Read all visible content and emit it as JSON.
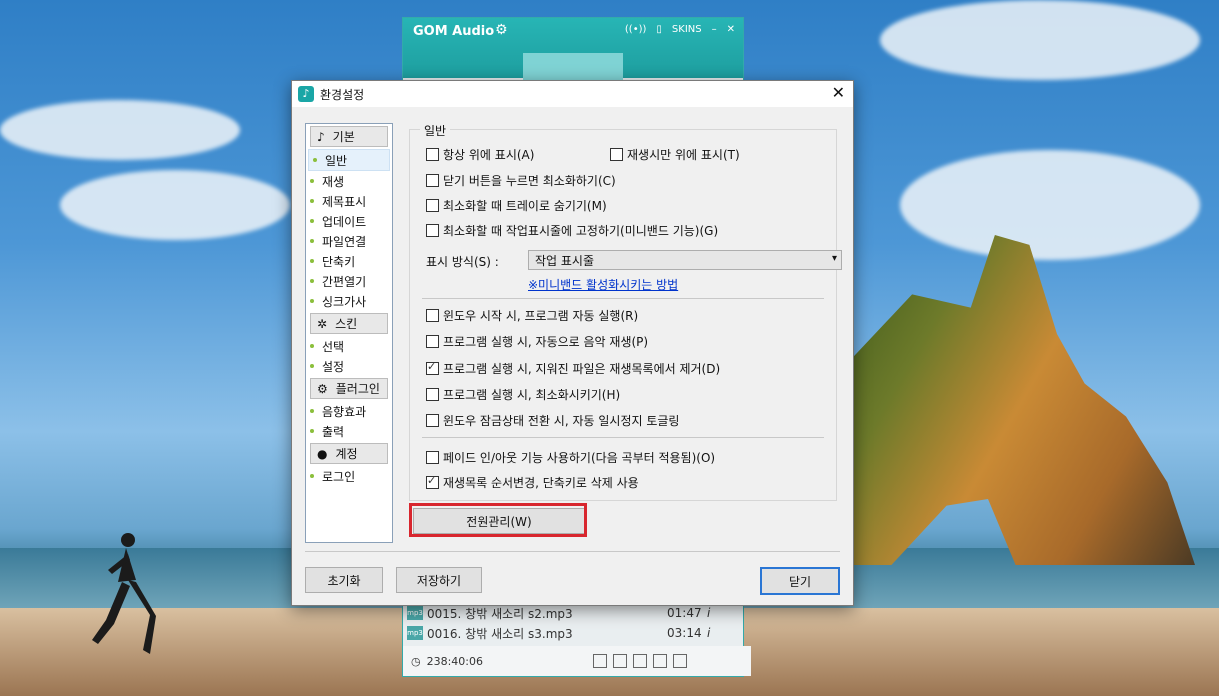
{
  "gom": {
    "title": "GOM Audio",
    "skins": "SKINS",
    "minimize": "–",
    "close": "✕",
    "playlist": [
      {
        "name": "0015. 창밖 새소리 s2.mp3",
        "time": "01:47",
        "info": "i"
      },
      {
        "name": "0016. 창밖 새소리 s3.mp3",
        "time": "03:14",
        "info": "i"
      }
    ],
    "total_time": "238:40:06",
    "mp3_badge": "mp3"
  },
  "dialog": {
    "title": "환경설정",
    "close": "✕",
    "nav": [
      {
        "type": "cat",
        "label": "기본",
        "icon": "music-note-icon"
      },
      {
        "type": "item",
        "label": "일반",
        "selected": true
      },
      {
        "type": "item",
        "label": "재생"
      },
      {
        "type": "item",
        "label": "제목표시"
      },
      {
        "type": "item",
        "label": "업데이트"
      },
      {
        "type": "item",
        "label": "파일연결"
      },
      {
        "type": "item",
        "label": "단축키"
      },
      {
        "type": "item",
        "label": "간편열기"
      },
      {
        "type": "item",
        "label": "싱크가사"
      },
      {
        "type": "cat",
        "label": "스킨",
        "icon": "magic-wand-icon"
      },
      {
        "type": "item",
        "label": "선택"
      },
      {
        "type": "item",
        "label": "설정"
      },
      {
        "type": "cat",
        "label": "플러그인",
        "icon": "gear-icon"
      },
      {
        "type": "item",
        "label": "음향효과"
      },
      {
        "type": "item",
        "label": "출력"
      },
      {
        "type": "cat",
        "label": "계정",
        "icon": "user-icon"
      },
      {
        "type": "item",
        "label": "로그인"
      }
    ],
    "group_label": "일반",
    "options": {
      "always_on_top": {
        "label": "항상 위에 표시(A)",
        "checked": false
      },
      "on_top_playing": {
        "label": "재생시만 위에 표시(T)",
        "checked": false
      },
      "minimize_on_close": {
        "label": "닫기 버튼을 누르면 최소화하기(C)",
        "checked": false
      },
      "hide_tray": {
        "label": "최소화할 때 트레이로 숨기기(M)",
        "checked": false
      },
      "pin_taskbar": {
        "label": "최소화할 때 작업표시줄에 고정하기(미니밴드 기능)(G)",
        "checked": false
      },
      "auto_start": {
        "label": "윈도우 시작 시, 프로그램 자동 실행(R)",
        "checked": false
      },
      "auto_play": {
        "label": "프로그램 실행 시, 자동으로 음악 재생(P)",
        "checked": false
      },
      "remove_deleted": {
        "label": "프로그램 실행 시, 지워진 파일은 재생목록에서 제거(D)",
        "checked": true
      },
      "start_minimized": {
        "label": "프로그램 실행 시, 최소화시키기(H)",
        "checked": false
      },
      "lock_pause": {
        "label": "윈도우 잠금상태 전환 시, 자동 일시정지 토글링",
        "checked": false
      },
      "fade": {
        "label": "페이드 인/아웃 기능 사용하기(다음 곡부터 적용됨)(O)",
        "checked": false
      },
      "playlist_shortcut": {
        "label": "재생목록 순서변경, 단축키로 삭제 사용",
        "checked": true
      }
    },
    "display_mode_label": "표시 방식(S) :",
    "display_mode_value": "작업 표시줄",
    "miniband_link": "※미니밴드 활성화시키는 방법",
    "power_button": "전원관리(W)",
    "reset_button": "초기화",
    "save_button": "저장하기",
    "close_button": "닫기"
  },
  "colors": {
    "accent": "#1aa6a6",
    "highlight": "#d8262e",
    "link": "#0033cc"
  }
}
